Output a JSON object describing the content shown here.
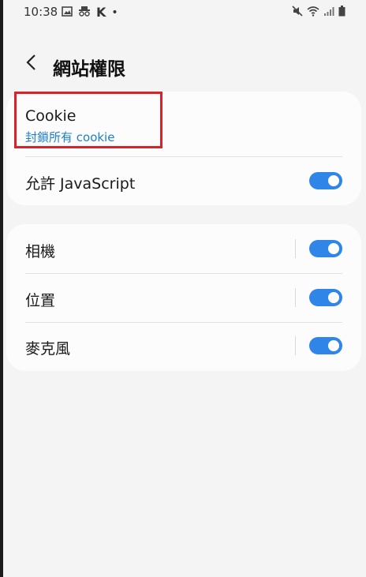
{
  "status_bar": {
    "time": "10:38",
    "k_glyph": "K",
    "dot_glyph": "•"
  },
  "header": {
    "title": "網站權限"
  },
  "card1": {
    "cookie_label": "Cookie",
    "cookie_value": "封鎖所有 cookie",
    "javascript_label": "允許 JavaScript",
    "javascript_on": true
  },
  "card2": {
    "items": [
      {
        "label": "相機",
        "on": true
      },
      {
        "label": "位置",
        "on": true
      },
      {
        "label": "麥克風",
        "on": true
      }
    ]
  },
  "colors": {
    "accent": "#2f86e8",
    "link": "#1f7fc4",
    "highlight": "#d8232a"
  }
}
